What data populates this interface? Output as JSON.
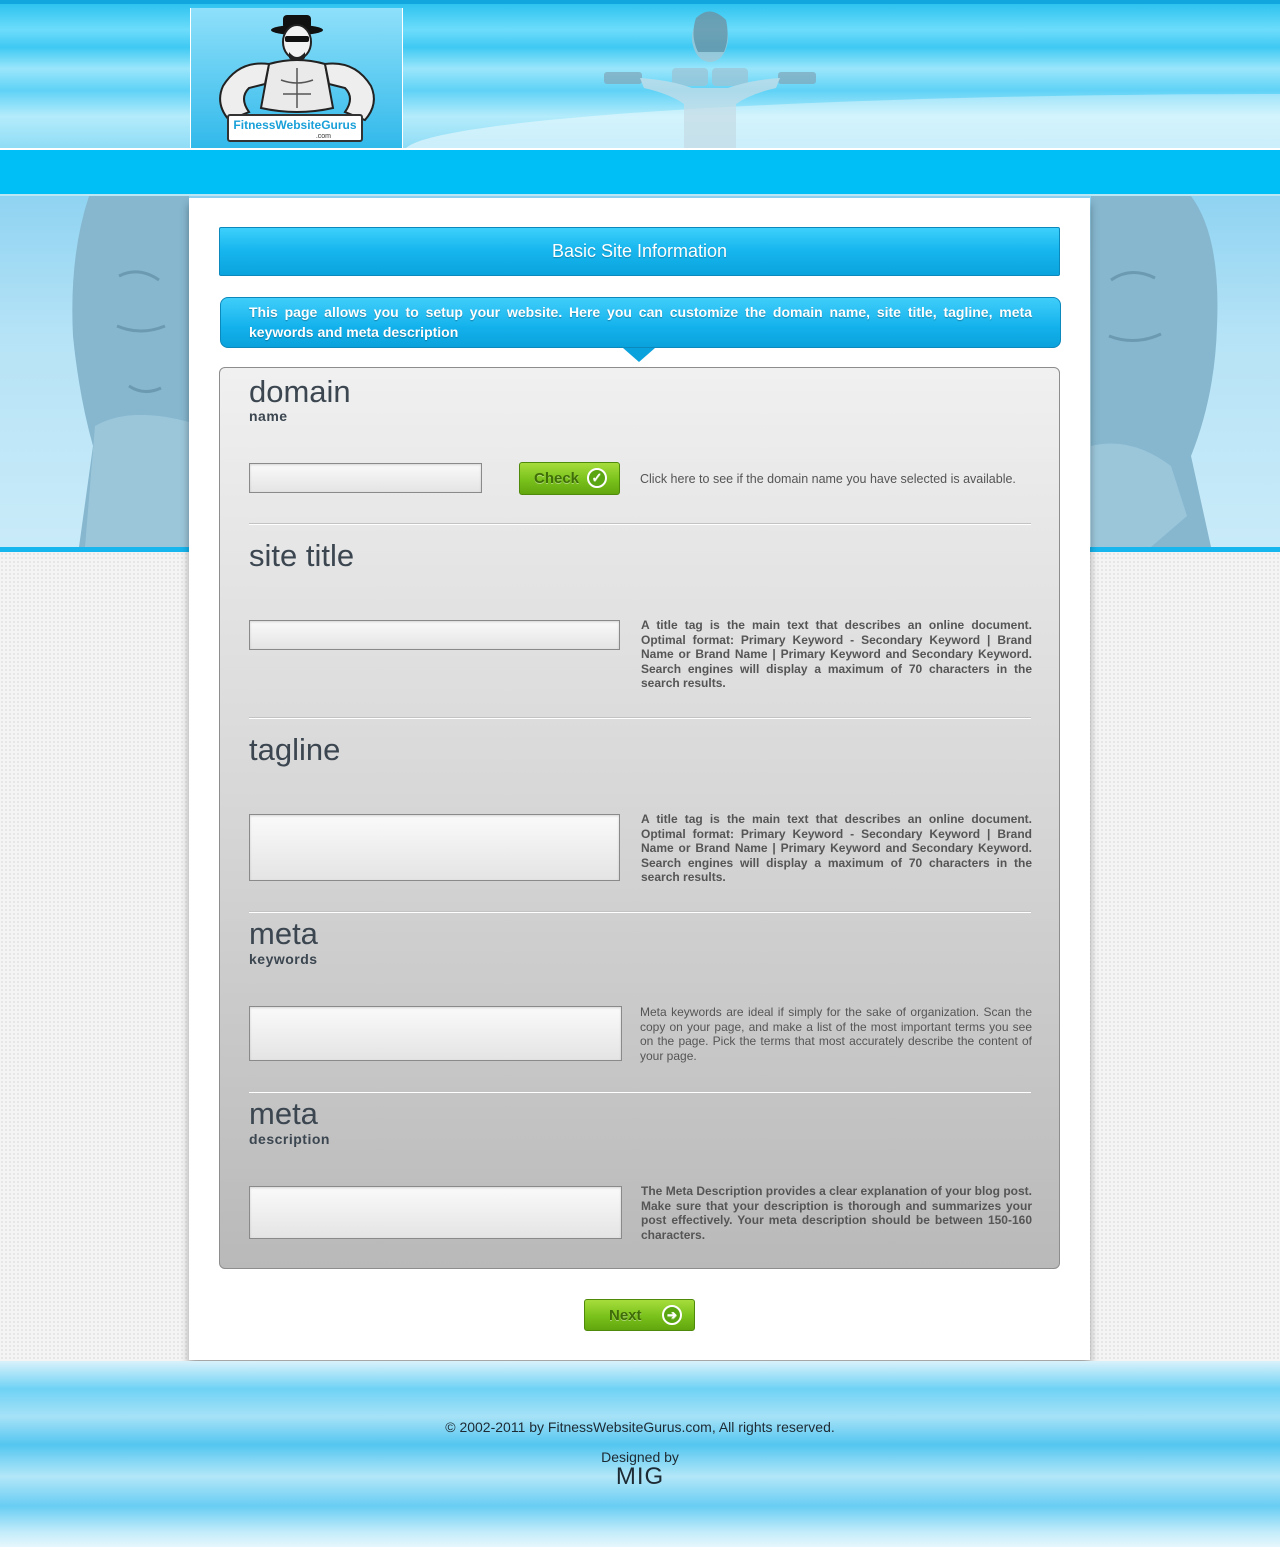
{
  "header": {
    "logo_brand": "FitnessWebsiteGurus",
    "logo_tld": ".com"
  },
  "main": {
    "title": "Basic Site Information",
    "intro": "This page allows you to setup your website. Here you can customize the domain name, site title, tagline, meta keywords and meta description"
  },
  "sections": {
    "domain": {
      "title": "domain",
      "subtitle": "name",
      "value": "",
      "check_label": "Check",
      "help": "Click here to see if the domain name you have selected is available."
    },
    "site_title": {
      "title": "site title",
      "value": "",
      "help": "A title tag is the main text that describes an online document. Optimal format: Primary Keyword - Secondary Keyword | Brand Name or Brand Name | Primary Keyword and Secondary Keyword. Search engines will display a maximum of 70 characters in the search results."
    },
    "tagline": {
      "title": "tagline",
      "value": "",
      "help": "A title tag is the main text that describes an online document. Optimal format: Primary Keyword - Secondary Keyword | Brand Name or Brand Name | Primary Keyword and Secondary Keyword. Search engines will display a maximum of 70 characters in the search results."
    },
    "meta_keywords": {
      "title": "meta",
      "subtitle": "keywords",
      "value": "",
      "help": "Meta keywords are ideal if simply for the sake of organization. Scan the copy on your page, and make a list of the most important terms you see on the page. Pick the terms that most accurately describe the content of your page."
    },
    "meta_description": {
      "title": "meta",
      "subtitle": "description",
      "value": "",
      "help": "The Meta Description provides a clear explanation of your blog post. Make sure that your description is thorough and summarizes your post effectively. Your meta description should be between 150-160 characters."
    }
  },
  "next_label": "Next",
  "footer": {
    "copyright": "© 2002-2011 by FitnessWebsiteGurus.com, All rights reserved.",
    "designed_by": "Designed by",
    "designer": "MIG"
  },
  "colors": {
    "accent": "#00bff7",
    "button_green": "#79c11b"
  },
  "icons": {
    "check": "checkmark-icon",
    "next": "arrow-right-icon"
  }
}
